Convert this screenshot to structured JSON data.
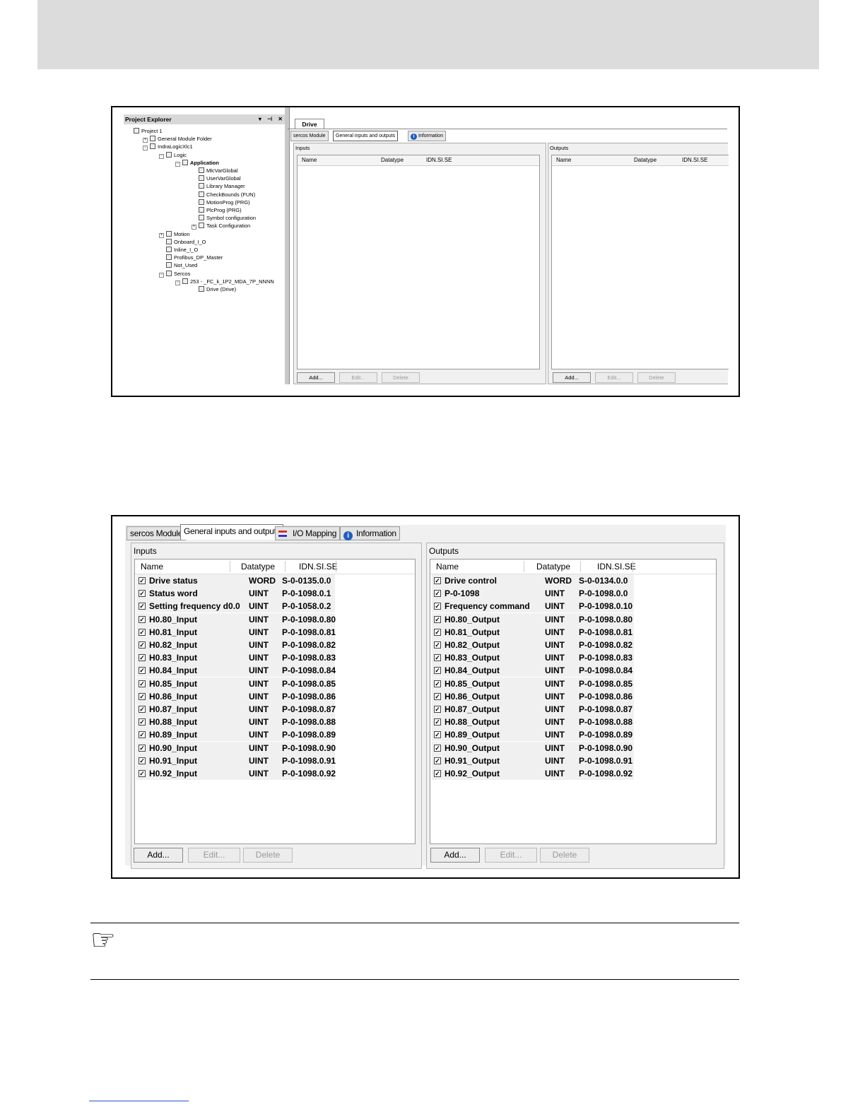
{
  "screenshot1": {
    "project_explorer": {
      "title": "Project Explorer",
      "controls": "▾ ⊣ ✕",
      "tree": [
        {
          "label": "Project 1",
          "indent": 0,
          "bold": false
        },
        {
          "label": "General Module Folder",
          "indent": 1,
          "bold": false
        },
        {
          "label": "IndraLogicXlc1",
          "indent": 1,
          "bold": false
        },
        {
          "label": "Logic",
          "indent": 2,
          "bold": false
        },
        {
          "label": "Application",
          "indent": 3,
          "bold": true
        },
        {
          "label": "MlcVarGlobal",
          "indent": 4,
          "bold": false
        },
        {
          "label": "UserVarGlobal",
          "indent": 4,
          "bold": false
        },
        {
          "label": "Library Manager",
          "indent": 4,
          "bold": false
        },
        {
          "label": "CheckBounds (FUN)",
          "indent": 4,
          "bold": false
        },
        {
          "label": "MotionProg (PRG)",
          "indent": 4,
          "bold": false
        },
        {
          "label": "PlcProg (PRG)",
          "indent": 4,
          "bold": false
        },
        {
          "label": "Symbol configuration",
          "indent": 4,
          "bold": false
        },
        {
          "label": "Task Configuration",
          "indent": 4,
          "bold": false
        },
        {
          "label": "Motion",
          "indent": 2,
          "bold": false
        },
        {
          "label": "Onboard_I_O",
          "indent": 2,
          "bold": false
        },
        {
          "label": "Inline_I_O",
          "indent": 2,
          "bold": false
        },
        {
          "label": "Profibus_DP_Master",
          "indent": 2,
          "bold": false
        },
        {
          "label": "Not_Used",
          "indent": 2,
          "bold": false
        },
        {
          "label": "Sercos",
          "indent": 2,
          "bold": false
        },
        {
          "label": "253 - _FC_k_1P2_MDA_7P_NNNN",
          "indent": 3,
          "bold": false
        },
        {
          "label": "Drive (Drive)",
          "indent": 4,
          "bold": false
        }
      ]
    },
    "editor_tab": "Drive",
    "tabs": [
      "sercos Module",
      "General inputs and outputs",
      "Information"
    ],
    "inputs": {
      "group_label": "Inputs",
      "columns": [
        "Name",
        "Datatype",
        "IDN.SI.SE"
      ]
    },
    "outputs": {
      "group_label": "Outputs",
      "columns": [
        "Name",
        "Datatype",
        "IDN.SI.SE"
      ]
    },
    "buttons": [
      "Add...",
      "Edit...",
      "Delete"
    ]
  },
  "screenshot2": {
    "tabs": [
      "sercos Module",
      "General inputs and outputs",
      "I/O Mapping",
      "Information"
    ],
    "inputs": {
      "group_label": "Inputs",
      "columns": [
        "Name",
        "Datatype",
        "IDN.SI.SE"
      ],
      "rows": [
        {
          "name": "Drive status",
          "type": "WORD",
          "idn": "S-0-0135.0.0"
        },
        {
          "name": "Status word",
          "type": "UINT",
          "idn": "P-0-1098.0.1"
        },
        {
          "name": "Setting frequency d0.0",
          "type": "UINT",
          "idn": "P-0-1058.0.2"
        },
        {
          "name": "H0.80_Input",
          "type": "UINT",
          "idn": "P-0-1098.0.80"
        },
        {
          "name": "H0.81_Input",
          "type": "UINT",
          "idn": "P-0-1098.0.81"
        },
        {
          "name": "H0.82_Input",
          "type": "UINT",
          "idn": "P-0-1098.0.82"
        },
        {
          "name": "H0.83_Input",
          "type": "UINT",
          "idn": "P-0-1098.0.83"
        },
        {
          "name": "H0.84_Input",
          "type": "UINT",
          "idn": "P-0-1098.0.84"
        },
        {
          "name": "H0.85_Input",
          "type": "UINT",
          "idn": "P-0-1098.0.85"
        },
        {
          "name": "H0.86_Input",
          "type": "UINT",
          "idn": "P-0-1098.0.86"
        },
        {
          "name": "H0.87_Input",
          "type": "UINT",
          "idn": "P-0-1098.0.87"
        },
        {
          "name": "H0.88_Input",
          "type": "UINT",
          "idn": "P-0-1098.0.88"
        },
        {
          "name": "H0.89_Input",
          "type": "UINT",
          "idn": "P-0-1098.0.89"
        },
        {
          "name": "H0.90_Input",
          "type": "UINT",
          "idn": "P-0-1098.0.90"
        },
        {
          "name": "H0.91_Input",
          "type": "UINT",
          "idn": "P-0-1098.0.91"
        },
        {
          "name": "H0.92_Input",
          "type": "UINT",
          "idn": "P-0-1098.0.92"
        }
      ]
    },
    "outputs": {
      "group_label": "Outputs",
      "columns": [
        "Name",
        "Datatype",
        "IDN.SI.SE"
      ],
      "rows": [
        {
          "name": "Drive control",
          "type": "WORD",
          "idn": "S-0-0134.0.0"
        },
        {
          "name": "P-0-1098",
          "type": "UINT",
          "idn": "P-0-1098.0.0"
        },
        {
          "name": "Frequency command",
          "type": "UINT",
          "idn": "P-0-1098.0.10"
        },
        {
          "name": "H0.80_Output",
          "type": "UINT",
          "idn": "P-0-1098.0.80"
        },
        {
          "name": "H0.81_Output",
          "type": "UINT",
          "idn": "P-0-1098.0.81"
        },
        {
          "name": "H0.82_Output",
          "type": "UINT",
          "idn": "P-0-1098.0.82"
        },
        {
          "name": "H0.83_Output",
          "type": "UINT",
          "idn": "P-0-1098.0.83"
        },
        {
          "name": "H0.84_Output",
          "type": "UINT",
          "idn": "P-0-1098.0.84"
        },
        {
          "name": "H0.85_Output",
          "type": "UINT",
          "idn": "P-0-1098.0.85"
        },
        {
          "name": "H0.86_Output",
          "type": "UINT",
          "idn": "P-0-1098.0.86"
        },
        {
          "name": "H0.87_Output",
          "type": "UINT",
          "idn": "P-0-1098.0.87"
        },
        {
          "name": "H0.88_Output",
          "type": "UINT",
          "idn": "P-0-1098.0.88"
        },
        {
          "name": "H0.89_Output",
          "type": "UINT",
          "idn": "P-0-1098.0.89"
        },
        {
          "name": "H0.90_Output",
          "type": "UINT",
          "idn": "P-0-1098.0.90"
        },
        {
          "name": "H0.91_Output",
          "type": "UINT",
          "idn": "P-0-1098.0.91"
        },
        {
          "name": "H0.92_Output",
          "type": "UINT",
          "idn": "P-0-1098.0.92"
        }
      ]
    },
    "buttons": [
      "Add...",
      "Edit...",
      "Delete"
    ],
    "checkmark": "✓"
  },
  "note": {
    "icon": "pointing-hand-icon",
    "glyph": "☞"
  }
}
